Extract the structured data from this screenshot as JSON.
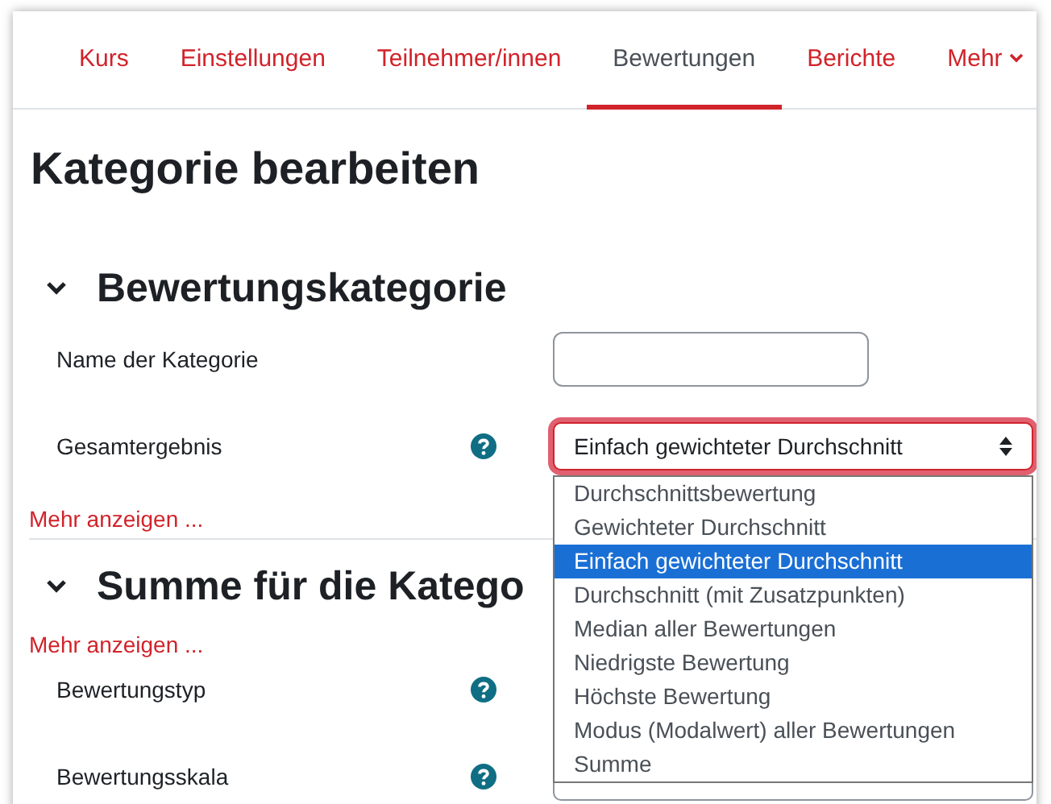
{
  "nav_tabs": [
    {
      "label": "Kurs",
      "selected": false
    },
    {
      "label": "Einstellungen",
      "selected": false
    },
    {
      "label": "Teilnehmer/innen",
      "selected": false
    },
    {
      "label": "Bewertungen",
      "selected": true
    },
    {
      "label": "Berichte",
      "selected": false
    },
    {
      "label": "Mehr",
      "selected": false,
      "kind": "menu"
    }
  ],
  "page_title": "Kategorie bearbeiten",
  "sections": [
    {
      "title": "Bewertungskategorie",
      "expanded": true,
      "fields": [
        {
          "label": "Name der Kategorie",
          "kind": "text",
          "help": false
        },
        {
          "label": "Gesamtergebnis",
          "kind": "select",
          "help": true,
          "value": "Einfach gewichteter Durchschnitt",
          "focused": true,
          "open": true,
          "options": [
            {
              "label": "Durchschnittsbewertung",
              "selected": false
            },
            {
              "label": "Gewichteter Durchschnitt",
              "selected": false
            },
            {
              "label": "Einfach gewichteter Durchschnitt",
              "selected": true
            },
            {
              "label": "Durchschnitt (mit Zusatzpunkten)",
              "selected": false
            },
            {
              "label": "Median aller Bewertungen",
              "selected": false
            },
            {
              "label": "Niedrigste Bewertung",
              "selected": false
            },
            {
              "label": "Höchste Bewertung",
              "selected": false
            },
            {
              "label": "Modus (Modalwert) aller Bewertungen",
              "selected": false
            },
            {
              "label": "Summe",
              "selected": false
            }
          ]
        }
      ],
      "more_link": "Mehr anzeigen ..."
    },
    {
      "title": "Summe für die Katego",
      "expanded": true,
      "more_link": "Mehr anzeigen ...",
      "fields": [
        {
          "label": "Bewertungstyp",
          "kind": "hidden",
          "help": true
        },
        {
          "label": "Bewertungsskala",
          "kind": "select",
          "help": true
        }
      ]
    }
  ]
}
